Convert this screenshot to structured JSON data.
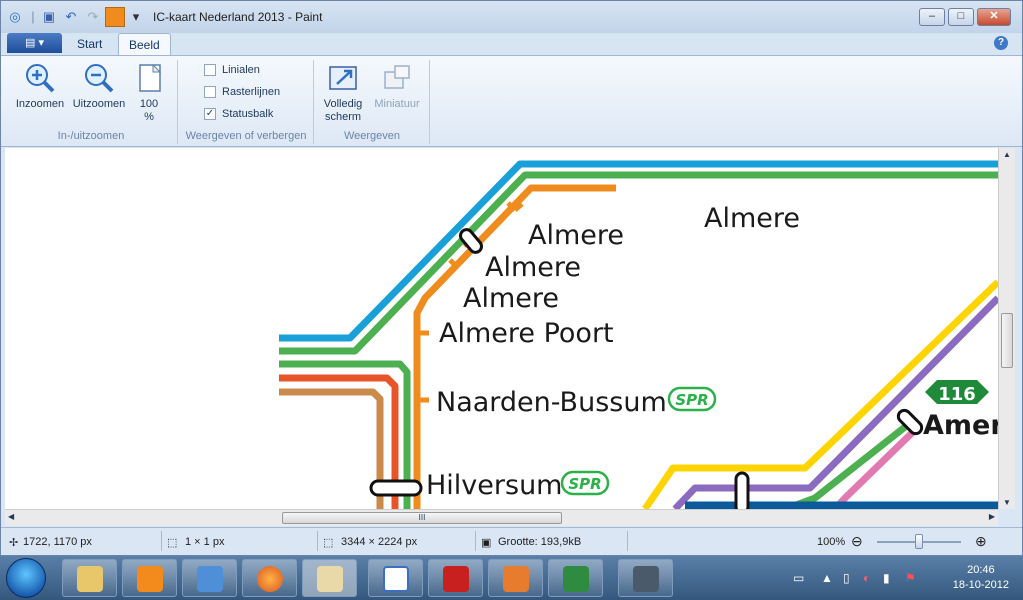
{
  "window": {
    "title": "IC-kaart Nederland 2013 - Paint",
    "controls": {
      "minimize": "‒",
      "maximize": "□",
      "close": "✕"
    }
  },
  "tabs": {
    "start": "Start",
    "beeld": "Beeld",
    "menu_glyph": "▤ ▾",
    "help": "?"
  },
  "ribbon": {
    "zoom_in": "Inzoomen",
    "zoom_out": "Uitzoomen",
    "zoom_100_a": "100",
    "zoom_100_b": "%",
    "group_zoom": "In-/uitzoomen",
    "rulers": "Linialen",
    "gridlines": "Rasterlijnen",
    "statusbar": "Statusbalk",
    "group_show": "Weergeven of verbergen",
    "fullscreen_a": "Volledig",
    "fullscreen_b": "scherm",
    "thumbnail": "Miniatuur",
    "group_display": "Weergeven"
  },
  "checks": {
    "rulers": false,
    "gridlines": false,
    "statusbar": true
  },
  "map": {
    "labels": {
      "almere_1": "Almere",
      "almere_2": "Almere",
      "almere_3": "Almere",
      "almere_right": "Almere",
      "almere_poort": "Almere Poort",
      "naarden_bussum": "Naarden-Bussum",
      "hilversum": "Hilversum",
      "spr_1": "SPR",
      "spr_2": "SPR",
      "route_116": "116",
      "amer": "Amer"
    },
    "line_colors": {
      "blue": "#1aa0d8",
      "green": "#4caf50",
      "orange": "#f08c1e",
      "red": "#e8542a",
      "brown": "#c98a4a",
      "yellow": "#ffd400",
      "purple": "#8b6bbf",
      "pink": "#e07ab0",
      "darkblue": "#0a5a9c"
    }
  },
  "hscroll_thumb": "III",
  "status": {
    "cursor": "1722, 1170 px",
    "selection": "1 × 1 px",
    "image_size": "3344 × 2224 px",
    "file_size": "Grootte: 193,9kB",
    "zoom": "100%"
  },
  "taskbar": {
    "time": "20:46",
    "date": "18-10-2012"
  }
}
